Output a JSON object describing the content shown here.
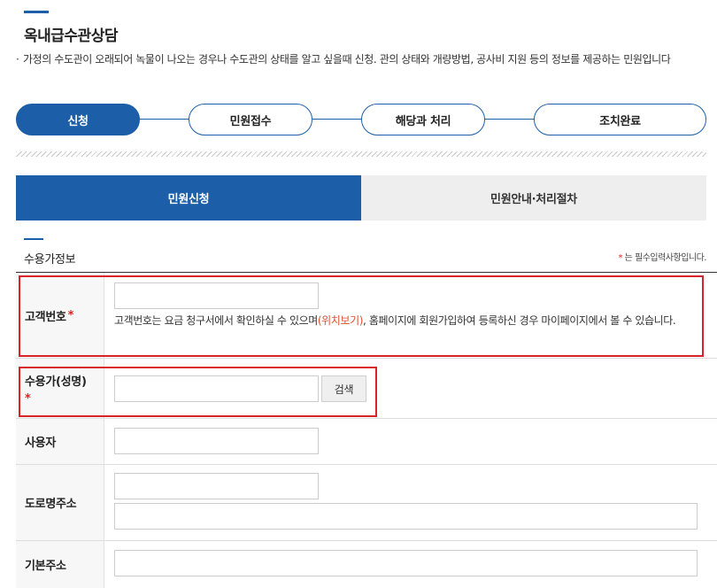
{
  "page": {
    "title": "옥내급수관상담",
    "description": "가정의 수도관이 오래되어 녹물이 나오는 경우나 수도관의 상태를 알고 싶을때 신청. 관의 상태와 개량방법, 공사비 지원 등의 정보를 제공하는 민원입니다"
  },
  "steps": [
    {
      "label": "신청"
    },
    {
      "label": "민원접수"
    },
    {
      "label": "해당과 처리"
    },
    {
      "label": "조치완료"
    }
  ],
  "tabs": [
    {
      "label": "민원신청"
    },
    {
      "label": "민원안내·처리절차"
    }
  ],
  "section": {
    "title": "수용가정보",
    "required_star": "*",
    "required_note": " 는 필수입력사항입니다."
  },
  "form": {
    "customer_number": {
      "label": "고객번호",
      "star": "*",
      "value": "",
      "help_before": "고객번호는 요금 청구서에서 확인하실 수 있으며",
      "help_link": "(위치보기)",
      "help_after": ", 홈페이지에 회원가입하여 등록하신 경우 마이페이지에서 볼 수 있습니다."
    },
    "customer_name": {
      "label": "수용가(성명)",
      "star": "*",
      "value": "",
      "search_label": "검색"
    },
    "user": {
      "label": "사용자",
      "value": ""
    },
    "road_address": {
      "label": "도로명주소",
      "value1": "",
      "value2": ""
    },
    "basic_address": {
      "label": "기본주소",
      "value": ""
    }
  },
  "colors": {
    "primary": "#1c5fa8",
    "required": "#e02020",
    "highlight": "#d8232a"
  }
}
